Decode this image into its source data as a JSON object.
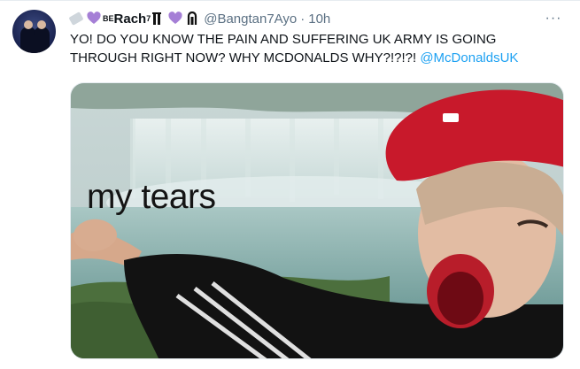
{
  "tweet": {
    "display_name": "Rach",
    "name_prefix_superscript": "BE",
    "name_superscript": "7",
    "handle": "@Bangtan7Ayo",
    "separator": "·",
    "time": "10h",
    "text_main": "YO! DO YOU KNOW THE PAIN AND SUFFERING UK ARMY IS GOING THROUGH RIGHT NOW? WHY MCDONALDS WHY?!?!?! ",
    "mention": "@McDonaldsUK",
    "more_icon": "···",
    "media_caption": "my tears"
  },
  "colors": {
    "accent": "#1da1f2",
    "secondary_text": "#5b7083",
    "heart": "#a57fd6"
  },
  "icons": [
    "ticket-icon",
    "purple-heart-icon",
    "pillars-icon",
    "more-icon"
  ]
}
